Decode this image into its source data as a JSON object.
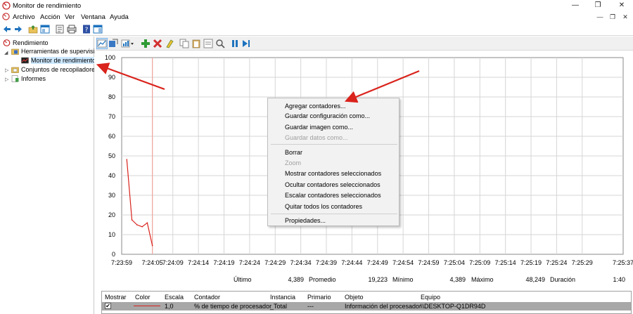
{
  "window": {
    "title": "Monitor de rendimiento"
  },
  "menu": [
    "Archivo",
    "Acción",
    "Ver",
    "Ventana",
    "Ayuda"
  ],
  "tree": {
    "root": "Rendimiento",
    "tools": "Herramientas de supervisió",
    "monitor": "Monitor de rendimiento",
    "collectors": "Conjuntos de recopiladores",
    "reports": "Informes"
  },
  "colors": {
    "accent": "#d9231c",
    "menu_bg": "#f2f2f2",
    "selection": "#cde8ff",
    "legend_row": "#a8a8a8"
  },
  "context_menu": {
    "add": "Agregar contadores...",
    "save_config": "Guardar configuración como...",
    "save_image": "Guardar imagen como...",
    "save_data": "Guardar datos como...",
    "delete": "Borrar",
    "zoom": "Zoom",
    "show": "Mostrar contadores seleccionados",
    "hide": "Ocultar contadores seleccionados",
    "scale": "Escalar contadores seleccionados",
    "remove_all": "Quitar todos los contadores",
    "properties": "Propiedades..."
  },
  "stats": {
    "last_label": "Último",
    "last_value": "4,389",
    "avg_label": "Promedio",
    "avg_value": "19,223",
    "min_label": "Mínimo",
    "min_value": "4,389",
    "max_label": "Máximo",
    "max_value": "48,249",
    "dur_label": "Duración",
    "dur_value": "1:40"
  },
  "legend": {
    "headers": [
      "Mostrar",
      "Color",
      "Escala",
      "Contador",
      "Instancia",
      "Primario",
      "Objeto",
      "Equipo"
    ],
    "row": {
      "show": "✔",
      "scale": "1,0",
      "counter": "% de tiempo de procesador",
      "instance": "_Total",
      "parent": "---",
      "object": "Información del procesador",
      "computer": "\\\\DESKTOP-Q1DR94D"
    }
  },
  "chart_data": {
    "type": "line",
    "title": "",
    "xlabel": "",
    "ylabel": "",
    "ylim": [
      0,
      100
    ],
    "yticks": [
      0,
      10,
      20,
      30,
      40,
      50,
      60,
      70,
      80,
      90,
      100
    ],
    "x_ticks": [
      "7:23:59",
      "7:24:05",
      "7:24:09",
      "7:24:14",
      "7:24:19",
      "7:24:24",
      "7:24:29",
      "7:24:34",
      "7:24:39",
      "7:24:44",
      "7:24:49",
      "7:24:54",
      "7:24:59",
      "7:25:04",
      "7:25:09",
      "7:25:14",
      "7:25:19",
      "7:25:24",
      "7:25:29",
      "7:25:37"
    ],
    "series": [
      {
        "x": [
          "7:24:00",
          "7:24:01",
          "7:24:02",
          "7:24:03",
          "7:24:04",
          "7:24:05"
        ],
        "values": [
          48.2,
          17.5,
          15,
          14,
          16,
          4.4
        ]
      }
    ],
    "cursor_at": "7:24:05",
    "grid": true
  }
}
